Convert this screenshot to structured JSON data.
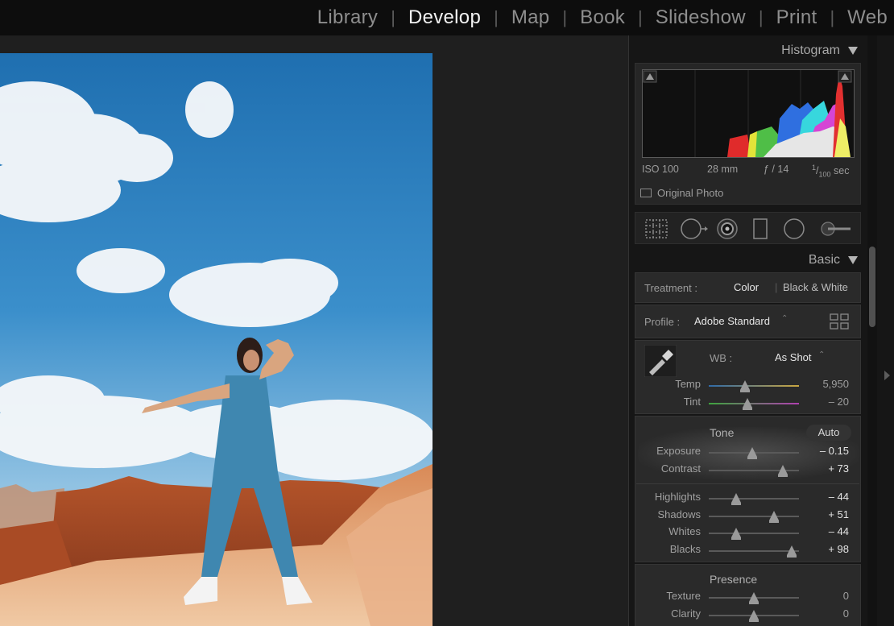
{
  "modules": [
    "Library",
    "Develop",
    "Map",
    "Book",
    "Slideshow",
    "Print",
    "Web"
  ],
  "active_module": "Develop",
  "histogram": {
    "title": "Histogram",
    "iso": "ISO 100",
    "focal": "28 mm",
    "aperture": "ƒ / 14",
    "shutter_num": "1",
    "shutter_den": "100",
    "shutter_unit": "sec",
    "original_photo": "Original Photo"
  },
  "tools": [
    "crop-overlay-icon",
    "spot-removal-icon",
    "red-eye-icon",
    "graduated-filter-icon",
    "radial-filter-icon",
    "adjustment-brush-icon"
  ],
  "basic": {
    "title": "Basic",
    "treatment_label": "Treatment :",
    "treatment_color": "Color",
    "treatment_bw": "Black & White",
    "profile_label": "Profile :",
    "profile_value": "Adobe Standard",
    "wb_label": "WB :",
    "wb_value": "As Shot",
    "temp": {
      "label": "Temp",
      "value": "5,950",
      "position": 0.4
    },
    "tint": {
      "label": "Tint",
      "value": "– 20",
      "position": 0.43
    },
    "tone_label": "Tone",
    "auto_label": "Auto",
    "exposure": {
      "label": "Exposure",
      "value": "– 0.15",
      "position": 0.48
    },
    "contrast": {
      "label": "Contrast",
      "value": "+ 73",
      "position": 0.82
    },
    "highlights": {
      "label": "Highlights",
      "value": "– 44",
      "position": 0.3
    },
    "shadows": {
      "label": "Shadows",
      "value": "+ 51",
      "position": 0.72
    },
    "whites": {
      "label": "Whites",
      "value": "– 44",
      "position": 0.3
    },
    "blacks": {
      "label": "Blacks",
      "value": "+ 98",
      "position": 0.92
    },
    "presence_label": "Presence",
    "texture": {
      "label": "Texture",
      "value": "0",
      "position": 0.5
    },
    "clarity": {
      "label": "Clarity",
      "value": "0",
      "position": 0.5
    }
  },
  "colors": {
    "accent_text": "#f2f2f2",
    "sky": "#2a7fbf",
    "rock": "#c86a3c"
  }
}
